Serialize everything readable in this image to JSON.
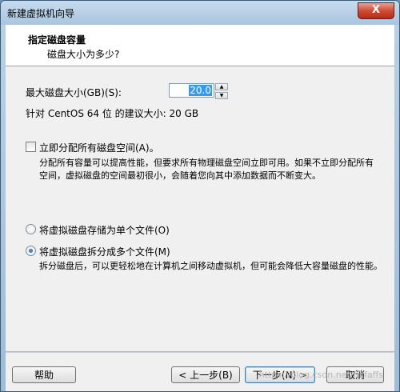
{
  "window": {
    "title": "新建虚拟机向导",
    "close_label": "X"
  },
  "header": {
    "title": "指定磁盘容量",
    "subtitle": "磁盘大小为多少?"
  },
  "disk": {
    "size_label": "最大磁盘大小(GB)(S):",
    "size_value": "20.0",
    "recommend_text": "针对 CentOS 64 位 的建议大小: 20 GB"
  },
  "allocate": {
    "label": "立即分配所有磁盘空间(A)。",
    "checked": false,
    "description": "分配所有容量可以提高性能，但要求所有物理磁盘空间立即可用。如果不立即分配所有空间，虚拟磁盘的空间最初很小，会随着您向其中添加数据而不断变大。"
  },
  "storage": {
    "single_label": "将虚拟磁盘存储为单个文件(O)",
    "multi_label": "将虚拟磁盘拆分成多个文件(M)",
    "selected": "multi",
    "multi_description": "拆分磁盘后，可以更轻松地在计算机之间移动虚拟机，但可能会降低大容量磁盘的性能。"
  },
  "footer": {
    "help_label": "帮助",
    "back_label": "< 上一步(B)",
    "next_label": "下一步(N) >",
    "cancel_label": "取消"
  },
  "watermark": "https://blog.csdn.net/ffcfaffs"
}
